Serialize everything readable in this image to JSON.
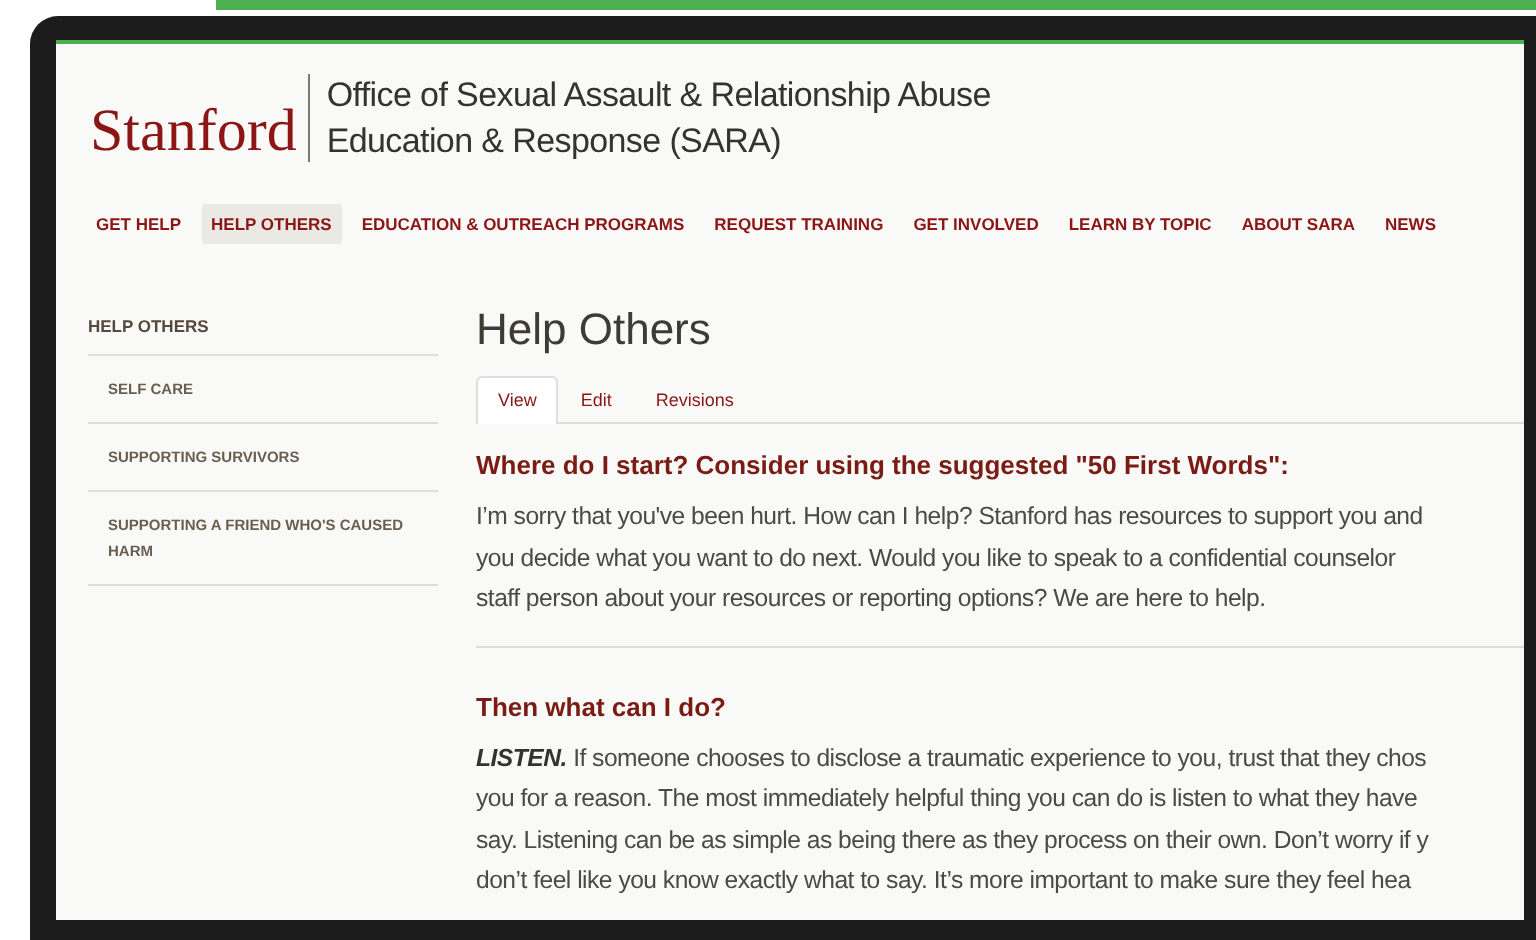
{
  "header": {
    "logo": "Stanford",
    "title_lines": [
      "Office of Sexual Assault & Relationship Abuse",
      "Education & Response (SARA)"
    ]
  },
  "nav": [
    {
      "label": "GET HELP",
      "selected": false
    },
    {
      "label": "HELP OTHERS",
      "selected": true
    },
    {
      "label": "EDUCATION & OUTREACH PROGRAMS",
      "selected": false
    },
    {
      "label": "REQUEST TRAINING",
      "selected": false
    },
    {
      "label": "GET INVOLVED",
      "selected": false
    },
    {
      "label": "LEARN BY TOPIC",
      "selected": false
    },
    {
      "label": "ABOUT SARA",
      "selected": false
    },
    {
      "label": "NEWS",
      "selected": false
    }
  ],
  "sidebar": {
    "heading": "HELP OTHERS",
    "items": [
      "SELF CARE",
      "SUPPORTING SURVIVORS",
      "SUPPORTING A FRIEND WHO'S CAUSED HARM"
    ]
  },
  "page_title": "Help Others",
  "tabs": [
    {
      "label": "View",
      "selected": true
    },
    {
      "label": "Edit",
      "selected": false
    },
    {
      "label": "Revisions",
      "selected": false
    }
  ],
  "sections": [
    {
      "heading": "Where do I start? Consider using the suggested \"50 First Words\":",
      "lines": [
        "I’m sorry that you've been hurt. How can I help? Stanford has resources to support you and",
        "you decide what you want to do next. Would you like to speak to a confidential counselor",
        "staff person about your resources or reporting options? We are here to help."
      ]
    },
    {
      "heading": "Then what can I do?",
      "lead": "LISTEN.",
      "lines": [
        "If someone chooses to disclose a traumatic experience to you, trust that they chos",
        "you for a reason. The most immediately helpful thing you can do is listen to what they have",
        "say. Listening can be as simple as being there as they process on their own. Don’t worry if y",
        "don’t feel like you know exactly what to say. It’s more important to make sure they feel hea"
      ]
    }
  ]
}
